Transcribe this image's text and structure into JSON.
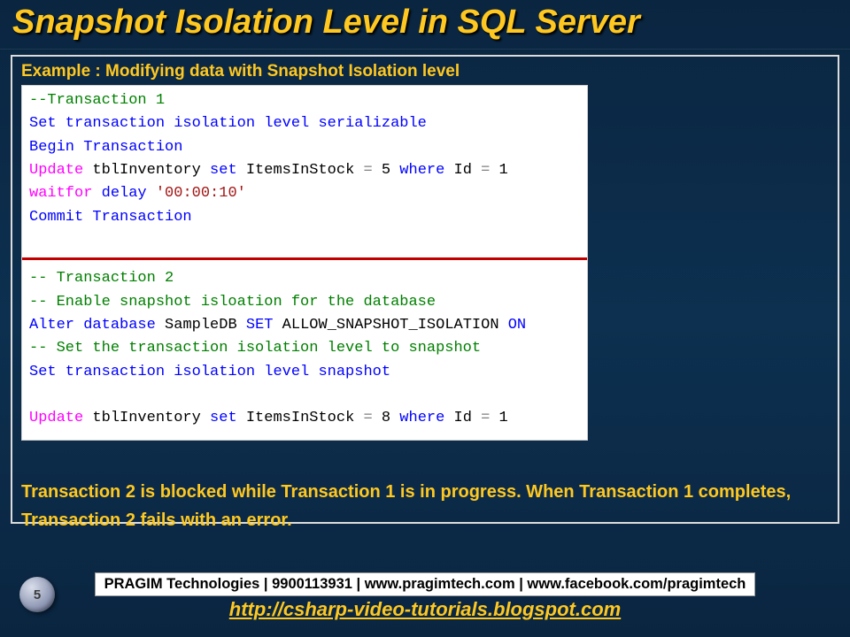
{
  "title": "Snapshot Isolation Level in SQL Server",
  "example_heading": "Example : Modifying data with Snapshot Isolation level",
  "code": {
    "t1_comment": "--Transaction 1",
    "t1_set_a": "Set transaction isolation level ",
    "t1_set_b": "serializable",
    "t1_begin_a": "Begin",
    "t1_begin_b": " Transaction",
    "t1_upd_a": "Update",
    "t1_upd_b": " tblInventory ",
    "t1_upd_c": "set",
    "t1_upd_d": " ItemsInStock ",
    "t1_upd_e": "=",
    "t1_upd_f": " 5 ",
    "t1_upd_g": "where",
    "t1_upd_h": " Id ",
    "t1_upd_i": "=",
    "t1_upd_j": " 1",
    "t1_wait_a": "waitfor",
    "t1_wait_b": " delay ",
    "t1_wait_c": "'00:00:10'",
    "t1_commit_a": "Commit",
    "t1_commit_b": " Transaction",
    "t2_comment1": "-- Transaction 2",
    "t2_comment2": "-- Enable snapshot isloation for the database",
    "t2_alter_a": "Alter",
    "t2_alter_b": " database",
    "t2_alter_c": " SampleDB ",
    "t2_alter_d": "SET",
    "t2_alter_e": " ALLOW_SNAPSHOT_ISOLATION ",
    "t2_alter_f": "ON",
    "t2_comment3": "-- Set the transaction isolation level to snapshot",
    "t2_set_a": "Set transaction isolation level ",
    "t2_set_b": "snapshot",
    "t2_upd_a": "Update",
    "t2_upd_b": " tblInventory ",
    "t2_upd_c": "set",
    "t2_upd_d": " ItemsInStock ",
    "t2_upd_e": "=",
    "t2_upd_f": " 8 ",
    "t2_upd_g": "where",
    "t2_upd_h": " Id ",
    "t2_upd_i": "=",
    "t2_upd_j": " 1"
  },
  "explanation": "Transaction 2 is blocked while Transaction 1 is in progress. When Transaction 1 completes, Transaction 2 fails with an error.",
  "footer_bar": "PRAGIM Technologies | 9900113931 | www.pragimtech.com | www.facebook.com/pragimtech",
  "footer_link": "http://csharp-video-tutorials.blogspot.com",
  "page_number": "5"
}
